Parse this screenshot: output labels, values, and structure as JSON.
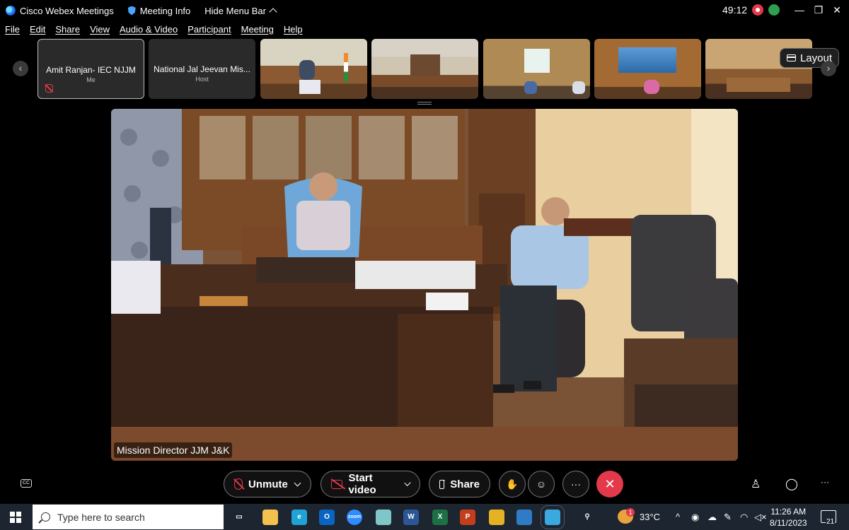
{
  "titlebar": {
    "app_name": "Cisco Webex Meetings",
    "meeting_info": "Meeting Info",
    "hide_menu": "Hide Menu Bar",
    "timer": "49:12",
    "minimize": "—",
    "restore": "❐",
    "close": "✕"
  },
  "menu": [
    "File",
    "Edit",
    "Share",
    "View",
    "Audio & Video",
    "Participant",
    "Meeting",
    "Help"
  ],
  "filmstrip": {
    "prev": "‹",
    "next": "›",
    "tiles": [
      {
        "name": "Amit Ranjan- IEC NJJM",
        "role": "Me"
      },
      {
        "name": "National Jal Jeevan Mis...",
        "role": "Host"
      }
    ],
    "layout_label": "Layout"
  },
  "main_video": {
    "speaker_label": "Mission Director JJM J&K"
  },
  "controls": {
    "unmute": "Unmute",
    "start_video": "Start video",
    "share": "Share",
    "more": "···",
    "end": "✕",
    "raise_hand": "✋",
    "reactions": "☺",
    "participants_icon": "♙",
    "chat_icon": "◯",
    "overflow": "···",
    "cc": "CC"
  },
  "taskbar": {
    "search_placeholder": "Type here to search",
    "apps": [
      {
        "name": "task-view",
        "glyph": "▭",
        "color": "#1c2530"
      },
      {
        "name": "file-explorer",
        "glyph": "",
        "color": "#f2c14e"
      },
      {
        "name": "edge",
        "glyph": "e",
        "color": "#1fa2d6"
      },
      {
        "name": "outlook",
        "glyph": "O",
        "color": "#0a64c2"
      },
      {
        "name": "zoom",
        "glyph": "zoom",
        "color": "#2d8cff"
      },
      {
        "name": "notepad",
        "glyph": "",
        "color": "#7fc6c9"
      },
      {
        "name": "word",
        "glyph": "W",
        "color": "#2b5797"
      },
      {
        "name": "excel",
        "glyph": "X",
        "color": "#1d7044"
      },
      {
        "name": "powerpoint",
        "glyph": "P",
        "color": "#c43e1c"
      },
      {
        "name": "chrome",
        "glyph": "",
        "color": "#e5b226"
      },
      {
        "name": "photos",
        "glyph": "",
        "color": "#2f7bc5"
      },
      {
        "name": "webex",
        "glyph": "",
        "color": "#3aa9e0"
      },
      {
        "name": "people",
        "glyph": "⚲",
        "color": "#1c2530"
      }
    ],
    "weather_badge": "1",
    "temperature": "33°C",
    "time": "11:26 AM",
    "date": "8/11/2023",
    "notification_count": "21"
  }
}
